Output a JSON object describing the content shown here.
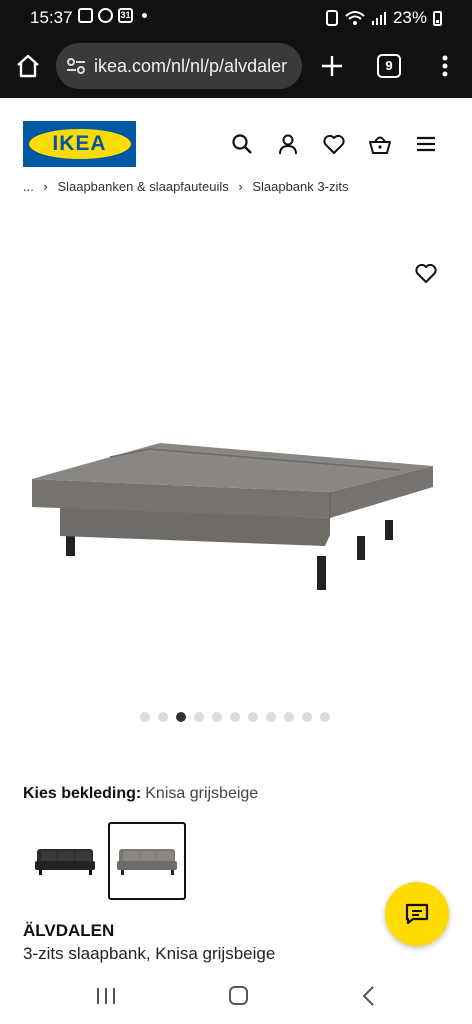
{
  "status_bar": {
    "time": "15:37",
    "calendar_day": "31",
    "battery": "23%"
  },
  "browser": {
    "url": "ikea.com/nl/nl/p/alvdaler",
    "tab_count": "9"
  },
  "site": {
    "logo_text": "IKEA"
  },
  "breadcrumb": [
    "...",
    "Slaapbanken & slaapfauteuils",
    "Slaapbank 3-zits"
  ],
  "carousel": {
    "total": 11,
    "active_index": 2
  },
  "product": {
    "option_label": "Kies bekleding:",
    "option_value": "Knisa grijsbeige",
    "name": "ÄLVDALEN",
    "description": "3-zits slaapbank, Knisa grijsbeige"
  },
  "colors": {
    "ikea_blue": "#0058a3",
    "ikea_yellow": "#ffdb00",
    "sofa_grey": "#7b7873",
    "sofa_dark": "#2b2b2b"
  }
}
